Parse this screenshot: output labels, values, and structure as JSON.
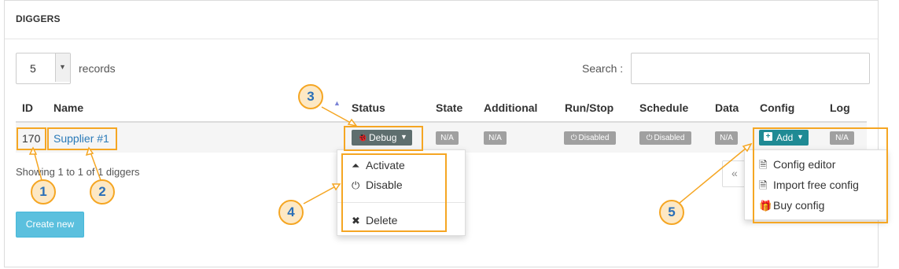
{
  "panel": {
    "title": "DIGGERS"
  },
  "length_menu": {
    "value": "5",
    "suffix": "records"
  },
  "search": {
    "label": "Search :",
    "value": ""
  },
  "table": {
    "headers": [
      "ID",
      "Name",
      "Status",
      "State",
      "Additional",
      "Run/Stop",
      "Schedule",
      "Data",
      "Config",
      "Log"
    ],
    "row": {
      "id": "170",
      "name": "Supplier #1",
      "status": "Debug",
      "state": "N/A",
      "additional": "N/A",
      "run_stop": "Disabled",
      "schedule": "Disabled",
      "data": "N/A",
      "config": "Add",
      "log": "N/A"
    }
  },
  "info": "Showing 1 to 1 of 1 diggers",
  "pager": {
    "prev": "«"
  },
  "create_button": "Create new",
  "status_menu": [
    {
      "icon": "chevron-up-circle-icon",
      "glyph": "⏶",
      "label": "Activate"
    },
    {
      "icon": "power-icon",
      "glyph": "⏻",
      "label": "Disable"
    },
    {
      "icon": "close-icon",
      "glyph": "✖",
      "label": "Delete"
    }
  ],
  "config_menu": [
    {
      "icon": "file-icon",
      "glyph": "🗎",
      "label": "Config editor"
    },
    {
      "icon": "file-text-icon",
      "glyph": "🗎",
      "label": "Import free config"
    },
    {
      "icon": "gift-icon",
      "glyph": "🎁",
      "label": "Buy config"
    }
  ],
  "callouts": [
    "1",
    "2",
    "3",
    "4",
    "5"
  ],
  "colors": {
    "accent": "#f5a623",
    "callout_text": "#2a6fb8",
    "link": "#2a7ab8",
    "debug_btn": "#5e6e6e",
    "add_btn": "#1f8a94",
    "create_btn": "#5bc0de",
    "badge": "#a0a0a0"
  }
}
